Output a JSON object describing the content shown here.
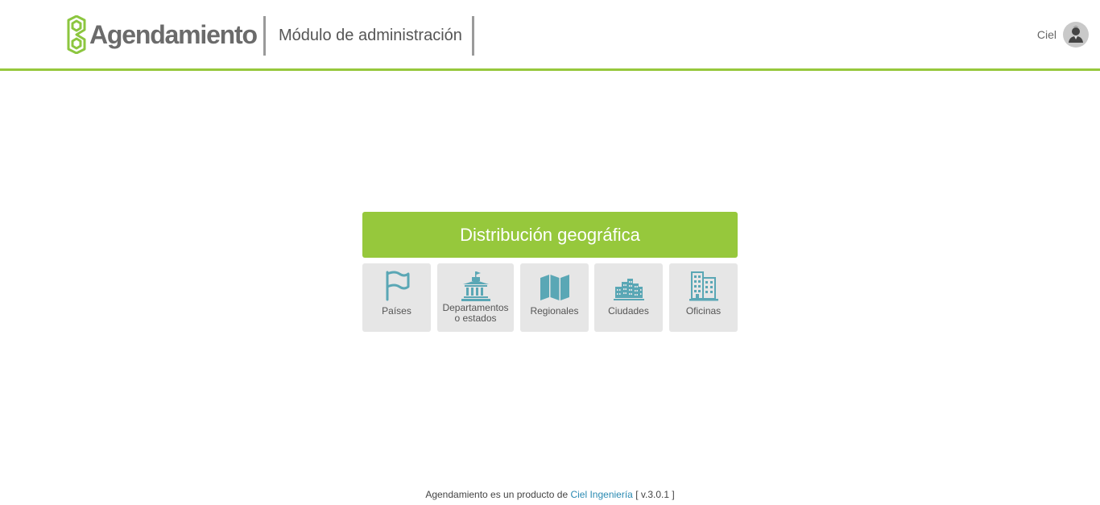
{
  "header": {
    "logo_text": "Agendamiento",
    "module_title": "Módulo de administración"
  },
  "user": {
    "name": "Ciel",
    "avatar_icon": "user-avatar-icon"
  },
  "panel": {
    "title": "Distribución geográfica",
    "tiles": [
      {
        "label": "Países",
        "icon": "flag-icon"
      },
      {
        "label_line1": "Departamentos",
        "label_line2": "o estados",
        "icon": "capitol-building-icon"
      },
      {
        "label": "Regionales",
        "icon": "map-icon"
      },
      {
        "label": "Ciudades",
        "icon": "city-icon"
      },
      {
        "label": "Oficinas",
        "icon": "office-building-icon"
      }
    ]
  },
  "footer": {
    "text_before": "Agendamiento es un producto de",
    "link_text": "Ciel Ingeniería",
    "version": "[ v.3.0.1 ]"
  },
  "colors": {
    "accent_green": "#96c83c",
    "icon_teal": "#5aa7b5",
    "link_blue": "#2a8ab2",
    "tile_bg": "#e6e6e6"
  }
}
